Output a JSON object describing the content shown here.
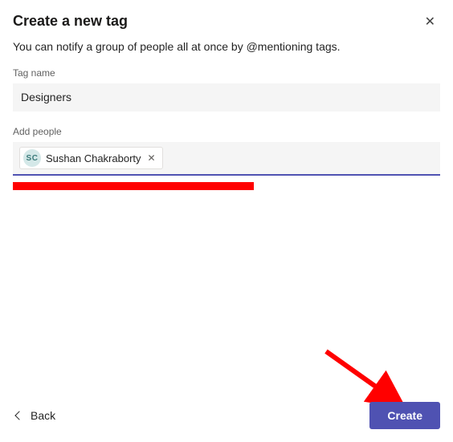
{
  "dialog": {
    "title": "Create a new tag",
    "subtitle": "You can notify a group of people all at once by @mentioning tags."
  },
  "fields": {
    "tag_name": {
      "label": "Tag name",
      "value": "Designers"
    },
    "add_people": {
      "label": "Add people",
      "chips": [
        {
          "initials": "SC",
          "name": "Sushan Chakraborty"
        }
      ]
    }
  },
  "footer": {
    "back_label": "Back",
    "create_label": "Create"
  },
  "annotation": {
    "arrow_color": "#ff0000",
    "redaction_color": "#ff0000"
  }
}
